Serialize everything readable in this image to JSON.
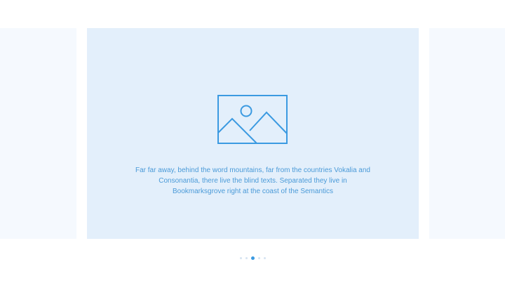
{
  "carousel": {
    "slides": [
      {
        "text": ""
      },
      {
        "image_icon": "image-placeholder-icon",
        "text": "Far far away, behind the word mountains, far from the countries Vokalia and Consonantia, there live the blind texts. Separated they live in Bookmarksgrove right at the coast of the Semantics"
      },
      {
        "text": ""
      }
    ],
    "active_index": 1,
    "pagination": {
      "count": 5,
      "active": 2
    }
  },
  "colors": {
    "accent": "#3b9ae1",
    "active_slide_bg": "#e3effb",
    "side_slide_bg": "#f5f9fe",
    "text": "#4a9ad8",
    "inactive_dot": "#d6e4f1"
  }
}
